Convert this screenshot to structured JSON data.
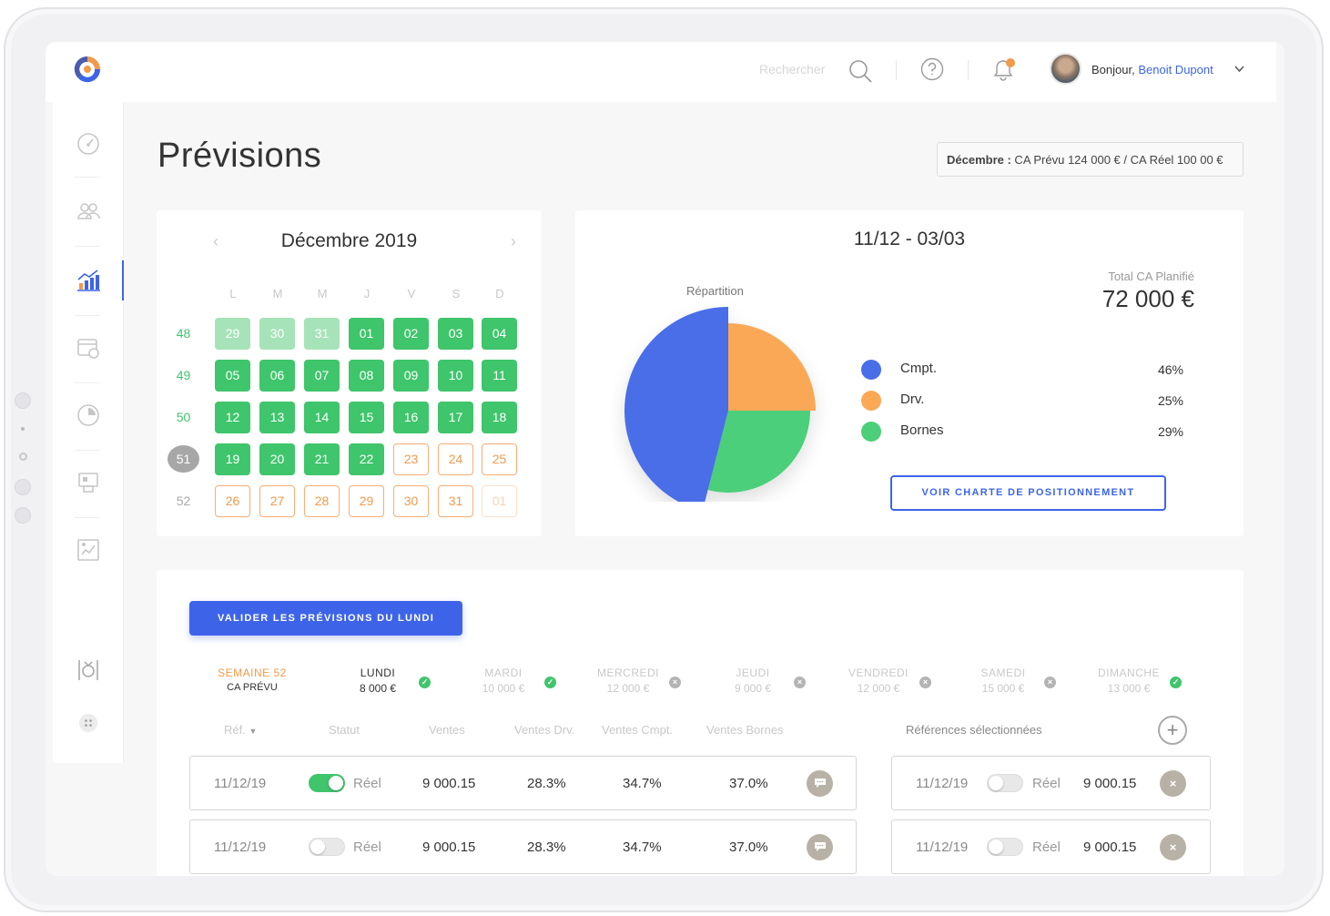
{
  "header": {
    "search_placeholder": "Rechercher",
    "greeting": "Bonjour,",
    "user_name": "Benoit Dupont"
  },
  "page": {
    "title": "Prévisions",
    "summary_month": "Décembre :",
    "summary_text": " CA Prévu 124 000 € / CA Réel 100 00 €"
  },
  "calendar": {
    "title": "Décembre 2019",
    "days_of_week": [
      "L",
      "M",
      "M",
      "J",
      "V",
      "S",
      "D"
    ],
    "weeks": [
      {
        "num": "48",
        "active": false,
        "days": [
          {
            "d": "29",
            "s": "light"
          },
          {
            "d": "30",
            "s": "light"
          },
          {
            "d": "31",
            "s": "light"
          },
          {
            "d": "01",
            "s": "green"
          },
          {
            "d": "02",
            "s": "green"
          },
          {
            "d": "03",
            "s": "green"
          },
          {
            "d": "04",
            "s": "green"
          }
        ]
      },
      {
        "num": "49",
        "active": false,
        "days": [
          {
            "d": "05",
            "s": "green"
          },
          {
            "d": "06",
            "s": "green"
          },
          {
            "d": "07",
            "s": "green"
          },
          {
            "d": "08",
            "s": "green"
          },
          {
            "d": "09",
            "s": "green"
          },
          {
            "d": "10",
            "s": "green"
          },
          {
            "d": "11",
            "s": "green"
          }
        ]
      },
      {
        "num": "50",
        "active": false,
        "days": [
          {
            "d": "12",
            "s": "green"
          },
          {
            "d": "13",
            "s": "green"
          },
          {
            "d": "14",
            "s": "green"
          },
          {
            "d": "15",
            "s": "green"
          },
          {
            "d": "16",
            "s": "green"
          },
          {
            "d": "17",
            "s": "green"
          },
          {
            "d": "18",
            "s": "green"
          }
        ]
      },
      {
        "num": "51",
        "active": true,
        "days": [
          {
            "d": "19",
            "s": "green"
          },
          {
            "d": "20",
            "s": "green"
          },
          {
            "d": "21",
            "s": "green"
          },
          {
            "d": "22",
            "s": "green"
          },
          {
            "d": "23",
            "s": "orange"
          },
          {
            "d": "24",
            "s": "orange"
          },
          {
            "d": "25",
            "s": "orange"
          }
        ]
      },
      {
        "num": "52",
        "active": false,
        "days": [
          {
            "d": "26",
            "s": "orange"
          },
          {
            "d": "27",
            "s": "orange"
          },
          {
            "d": "28",
            "s": "orange"
          },
          {
            "d": "29",
            "s": "orange"
          },
          {
            "d": "30",
            "s": "orange"
          },
          {
            "d": "31",
            "s": "orange"
          },
          {
            "d": "01",
            "s": "faint"
          }
        ]
      }
    ]
  },
  "repartition": {
    "range": "11/12 - 03/03",
    "pie_label": "Répartition",
    "total_label": "Total CA Planifié",
    "total_value": "72 000 €",
    "button": "VOIR CHARTE DE POSITIONNEMENT",
    "legend": [
      {
        "label": "Cmpt.",
        "pct": "46%",
        "color": "#4a6ee8"
      },
      {
        "label": "Drv.",
        "pct": "25%",
        "color": "#fba856"
      },
      {
        "label": "Bornes",
        "pct": "29%",
        "color": "#4ccf7a"
      }
    ]
  },
  "week": {
    "validate_button": "VALIDER LES PRÉVISIONS DU LUNDI",
    "week_label": "SEMAINE 52",
    "week_sub": "CA PRÉVU",
    "days": [
      {
        "name": "LUNDI",
        "value": "8 000 €",
        "status": "ok",
        "active": true
      },
      {
        "name": "MARDI",
        "value": "10 000 €",
        "status": "ok",
        "active": false
      },
      {
        "name": "MERCREDI",
        "value": "12 000 €",
        "status": "ko",
        "active": false
      },
      {
        "name": "JEUDI",
        "value": "9 000 €",
        "status": "ko",
        "active": false
      },
      {
        "name": "VENDREDI",
        "value": "12 000 €",
        "status": "ko",
        "active": false
      },
      {
        "name": "SAMEDI",
        "value": "15 000 €",
        "status": "ko",
        "active": false
      },
      {
        "name": "DIMANCHE",
        "value": "13 000 €",
        "status": "ok",
        "active": false
      }
    ]
  },
  "table": {
    "columns": [
      "Réf.",
      "Statut",
      "Ventes",
      "Ventes Drv.",
      "Ventes Cmpt.",
      "Ventes Bornes"
    ],
    "selected_title": "Références sélectionnées",
    "rows": [
      {
        "ref": "11/12/19",
        "on": true,
        "status": "Réel",
        "ventes": "9 000.15",
        "drv": "28.3%",
        "cmpt": "34.7%",
        "bornes": "37.0%"
      },
      {
        "ref": "11/12/19",
        "on": false,
        "status": "Réel",
        "ventes": "9 000.15",
        "drv": "28.3%",
        "cmpt": "34.7%",
        "bornes": "37.0%"
      }
    ],
    "selected": [
      {
        "ref": "11/12/19",
        "on": false,
        "status": "Réel",
        "ventes": "9 000.15"
      },
      {
        "ref": "11/12/19",
        "on": false,
        "status": "Réel",
        "ventes": "9 000.15"
      }
    ]
  },
  "colors": {
    "accent": "#3d64e8",
    "green": "#3fc56b",
    "orange": "#f29a4b"
  }
}
